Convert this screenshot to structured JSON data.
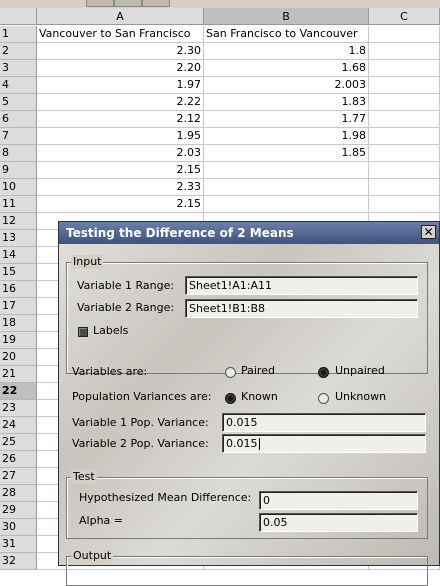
{
  "sheet": {
    "columns": [
      {
        "label": "A"
      },
      {
        "label": "B"
      },
      {
        "label": "C"
      }
    ],
    "rows": [
      "1",
      "2",
      "3",
      "4",
      "5",
      "6",
      "7",
      "8",
      "9",
      "10",
      "11",
      "12",
      "13",
      "14",
      "15",
      "16",
      "17",
      "18",
      "19",
      "20",
      "21",
      "22",
      "23",
      "24",
      "25",
      "26",
      "27",
      "28",
      "29",
      "30",
      "31",
      "32"
    ],
    "selected_row": "22",
    "header_a": "Vancouver to San Francisco",
    "header_b": "San Francisco to Vancouver",
    "col_a": [
      "2.30",
      "2.20",
      "1.97",
      "2.22",
      "2.12",
      "1.95",
      "2.03",
      "2.15",
      "2.33",
      "2.15"
    ],
    "col_b": [
      "1.8",
      "1.68",
      "2.003",
      "1.83",
      "1.77",
      "1.98",
      "1.85"
    ]
  },
  "dialog": {
    "title": "Testing the Difference of 2 Means",
    "close": "✕",
    "input": {
      "legend": "Input",
      "var1_label_pre": "Variable 1 Range:",
      "var1_value": "Sheet1!A1:A11",
      "var2_label_pre": "Variable 2 Range:",
      "var2_value": "Sheet1!B1:B8",
      "labels_label": "Labels",
      "labels_checked": true
    },
    "variables_are": {
      "label": "Variables are:",
      "paired": "Paired",
      "unpaired": "Unpaired",
      "selected": "unpaired"
    },
    "pop_variances": {
      "label": "Population Variances are:",
      "known": "Known",
      "unknown": "Unknown",
      "selected": "known"
    },
    "var1_pop_label": "Variable 1 Pop. Variance:",
    "var1_pop_value": "0.015",
    "var2_pop_label": "Variable 2 Pop. Variance:",
    "var2_pop_value": "0.015",
    "test": {
      "legend": "Test",
      "hyp_label": "Hypothesized Mean Difference:",
      "hyp_value": "0",
      "alpha_label": "Alpha =",
      "alpha_value": "0.05"
    },
    "output": {
      "legend": "Output"
    }
  }
}
